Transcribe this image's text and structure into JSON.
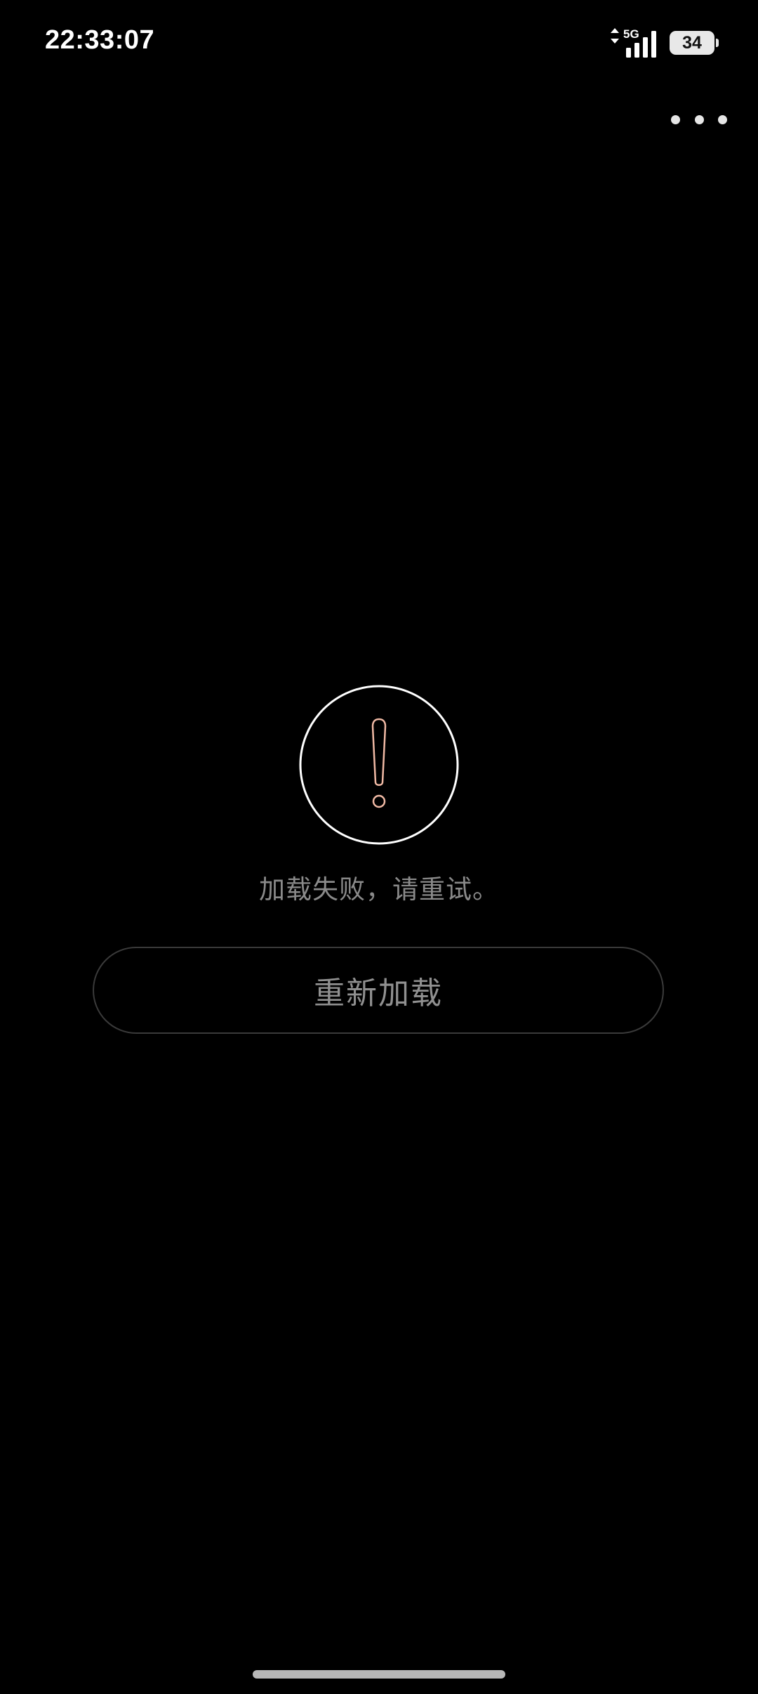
{
  "status_bar": {
    "time": "22:33:07",
    "network_type": "5G",
    "battery_level": "34",
    "signal_icon": "signal-bars-icon",
    "data_arrows_icon": "data-transfer-arrows-icon"
  },
  "top_actions": {
    "more_icon": "more-horizontal-icon"
  },
  "error": {
    "icon": "exclamation-circle-icon",
    "message": "加载失败，请重试。",
    "reload_label": "重新加载"
  },
  "colors": {
    "background": "#000000",
    "icon_ring": "#ffffff",
    "exclamation_stroke": "#f0b9a4",
    "message_text": "#8a8a8a",
    "button_border": "#3a3a3a",
    "button_text": "#909090"
  }
}
